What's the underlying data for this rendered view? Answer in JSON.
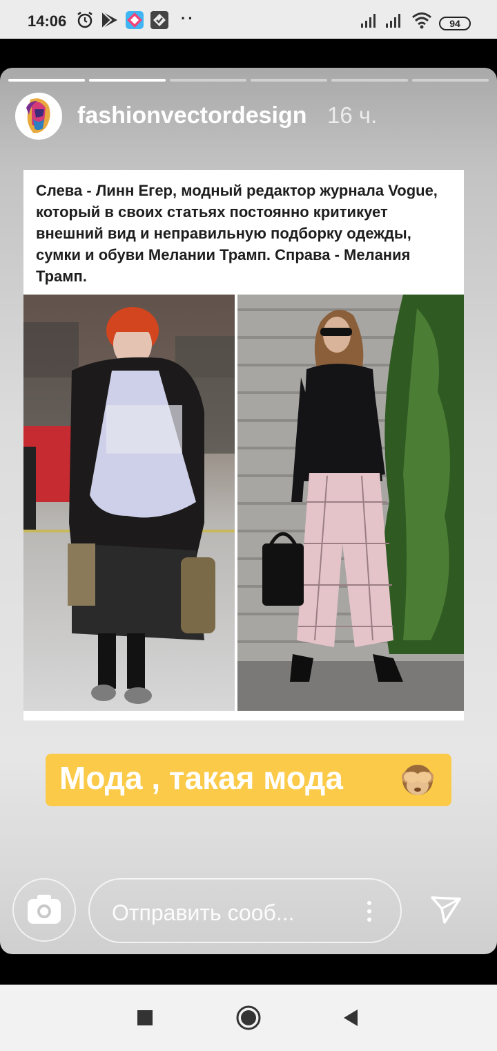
{
  "status_bar": {
    "time": "14:06",
    "icons": [
      "alarm-icon",
      "play-store-icon",
      "app-icon",
      "app-icon-2"
    ],
    "more": "··",
    "battery": "94"
  },
  "story": {
    "progress_segments": 6,
    "progress_done": 2,
    "username": "fashionvectordesign",
    "time_ago": "16 ч.",
    "caption": "Слева - Линн Егер, модный редактор журнала Vogue, который в своих статьях постоянно критикует внешний вид и неправильную подборку одежды, сумки и обуви Мелании Трамп. Справа - Мелания Трамп.",
    "sticker_text": "Мода , такая мода",
    "sticker_emoji": "see-no-evil-monkey-icon",
    "sticker_color": "#fbca49"
  },
  "reply_bar": {
    "placeholder": "Отправить сооб..."
  },
  "colors": {
    "status_bg": "#ececec",
    "nav_bg": "#f2f2f2"
  }
}
